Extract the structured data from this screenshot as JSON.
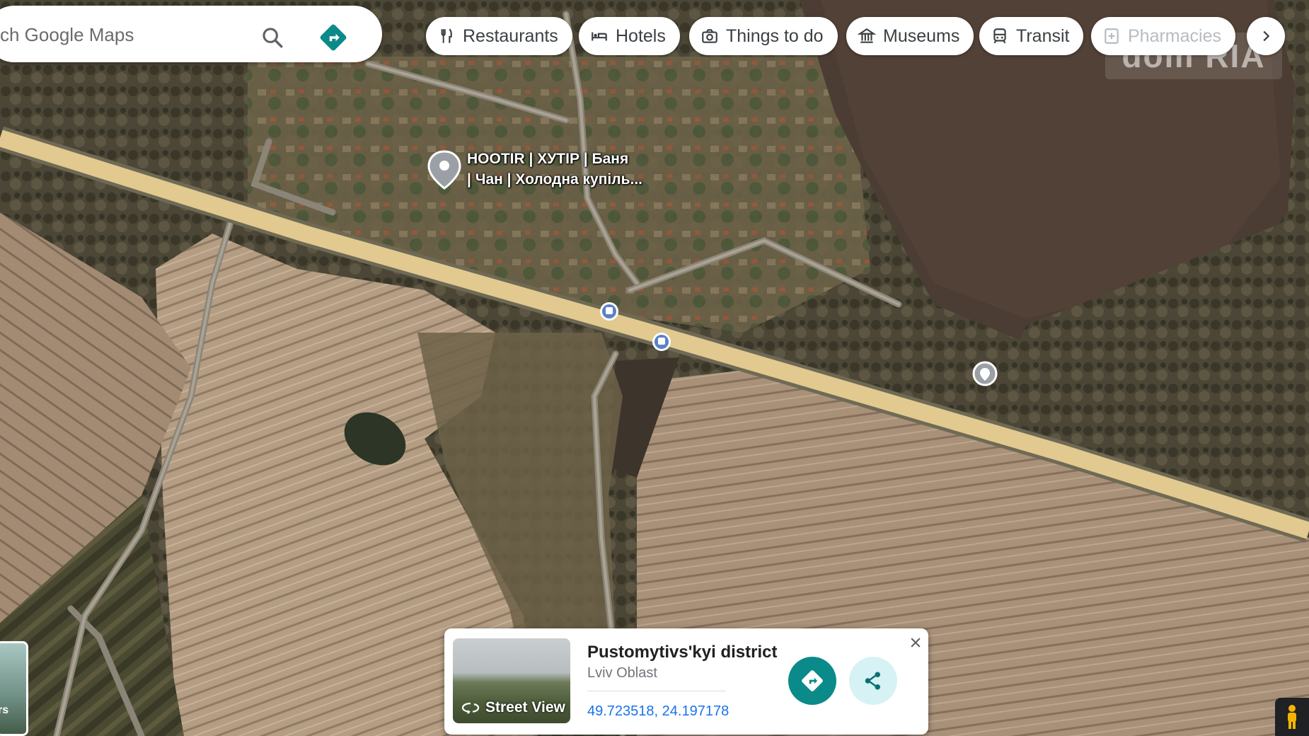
{
  "search": {
    "placeholder": "ch Google Maps",
    "icon": "search-icon",
    "directions_icon": "directions-icon"
  },
  "chips": [
    {
      "label": "Restaurants",
      "icon": "restaurant-icon"
    },
    {
      "label": "Hotels",
      "icon": "hotel-icon"
    },
    {
      "label": "Things to do",
      "icon": "camera-icon"
    },
    {
      "label": "Museums",
      "icon": "museum-icon"
    },
    {
      "label": "Transit",
      "icon": "transit-icon"
    },
    {
      "label": "Pharmacies",
      "icon": "pharmacy-icon"
    }
  ],
  "chip_next_icon": "chevron-right-icon",
  "watermark": {
    "text": "dom RIA"
  },
  "map": {
    "road_color": "#e2c98f",
    "place_label_line1": "HOOTIR | ХУТІР | Баня",
    "place_label_line2": "| Чан | Холодна купіль..."
  },
  "card": {
    "title": "Pustomytivs'kyi district",
    "subtitle": "Lviv Oblast",
    "coordinates": "49.723518, 24.197178",
    "street_view_label": "Street View",
    "directions_button_color": "#0b8a8a",
    "share_button_color": "#d6f2f4"
  },
  "layers": {
    "label": "rs"
  }
}
